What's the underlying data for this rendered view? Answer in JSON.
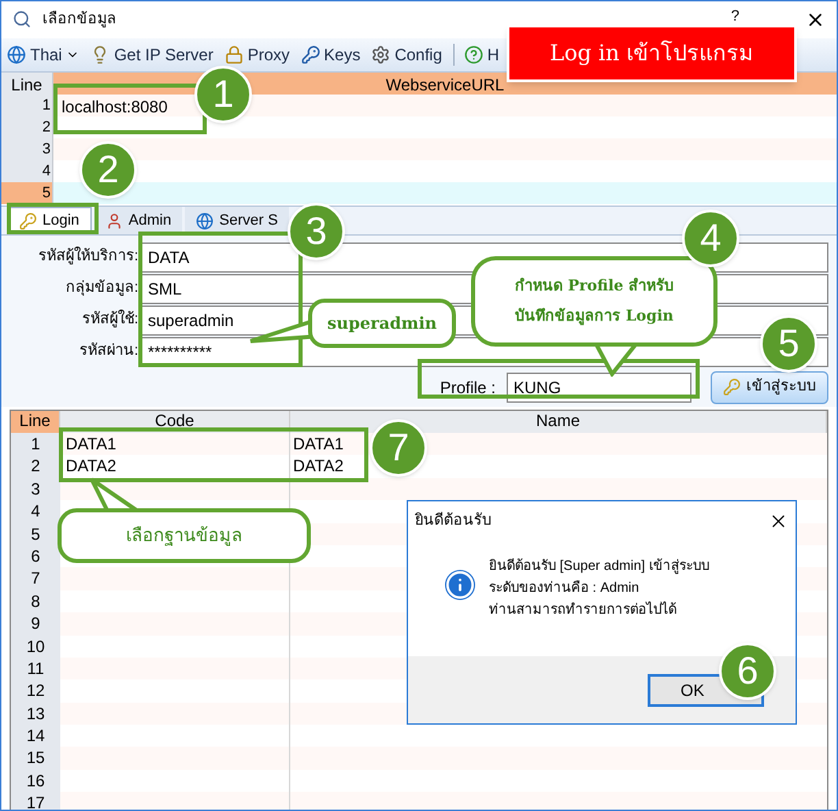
{
  "window": {
    "title": "เลือกข้อมูล",
    "help": "?"
  },
  "toolbar": [
    {
      "kind": "globe",
      "label": "Thai",
      "dropdown": true
    },
    {
      "kind": "bulb",
      "label": "Get IP Server"
    },
    {
      "kind": "lock",
      "label": "Proxy"
    },
    {
      "kind": "keys",
      "label": "Keys"
    },
    {
      "kind": "gear",
      "label": "Config"
    },
    {
      "kind": "help",
      "label": "H"
    }
  ],
  "url_grid": {
    "columns": [
      "Line",
      "WebserviceURL"
    ],
    "rows": [
      {
        "line": "1",
        "url": "localhost:8080",
        "selected": false
      },
      {
        "line": "2",
        "selected": false
      },
      {
        "line": "3",
        "selected": false
      },
      {
        "line": "4",
        "selected": false
      },
      {
        "line": "5",
        "selected": true
      }
    ]
  },
  "tabs": [
    {
      "kind": "key",
      "label": "Login",
      "selected": true
    },
    {
      "kind": "user",
      "label": "Admin",
      "selected": false
    },
    {
      "kind": "globe",
      "label": "Server S",
      "selected": false
    }
  ],
  "login_form": {
    "fields": [
      {
        "label": "รหัสผู้ให้บริการ:",
        "value": "DATA"
      },
      {
        "label": "กลุ่มข้อมูล:",
        "value": "SML"
      },
      {
        "label": "รหัสผู้ใช้:",
        "value": "superadmin"
      },
      {
        "label": "รหัสผ่าน:",
        "value": "**********"
      }
    ],
    "profile": {
      "label": "Profile :",
      "value": "KUNG"
    },
    "login_button": "เข้าสู่ระบบ"
  },
  "db_grid": {
    "columns": [
      "Line",
      "Code",
      "Name"
    ],
    "rows": [
      {
        "line": "1",
        "code": "DATA1",
        "name": "DATA1"
      },
      {
        "line": "2",
        "code": "DATA2",
        "name": "DATA2"
      },
      {
        "line": "3"
      },
      {
        "line": "4"
      },
      {
        "line": "5"
      },
      {
        "line": "6"
      },
      {
        "line": "7"
      },
      {
        "line": "8"
      },
      {
        "line": "9"
      },
      {
        "line": "10"
      },
      {
        "line": "11"
      },
      {
        "line": "12"
      },
      {
        "line": "13"
      },
      {
        "line": "14"
      },
      {
        "line": "15"
      },
      {
        "line": "16"
      },
      {
        "line": "17"
      }
    ]
  },
  "dialog": {
    "title": "ยินดีต้อนรับ",
    "lines": [
      "ยินดีต้อนรับ [Super admin] เข้าสู่ระบบ",
      "ระดับของท่านคือ : Admin",
      "ท่านสามารถทำรายการต่อไปได้"
    ],
    "ok": "OK"
  },
  "annotations": {
    "banner": "Log in เข้าโปรแกรม",
    "steps": [
      "1",
      "2",
      "3",
      "4",
      "5",
      "6",
      "7"
    ],
    "callouts": [
      "superadmin",
      "กำหนด Profile สำหรับ บันทึกข้อมูลการ Login",
      "เลือกฐานข้อมูล"
    ]
  }
}
